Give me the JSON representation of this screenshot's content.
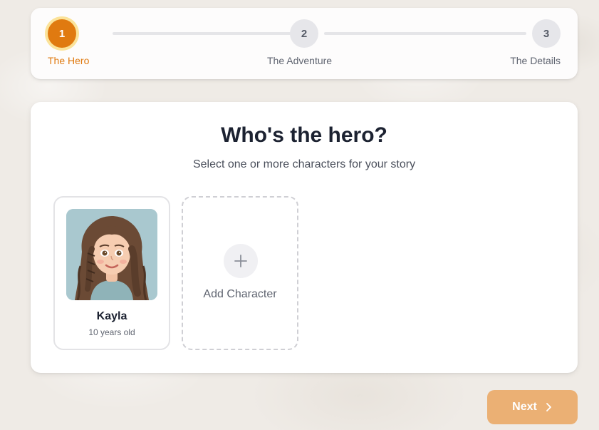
{
  "stepper": {
    "steps": [
      {
        "number": "1",
        "label": "The Hero"
      },
      {
        "number": "2",
        "label": "The Adventure"
      },
      {
        "number": "3",
        "label": "The Details"
      }
    ],
    "active_step": 1,
    "active_color": "#e07a10"
  },
  "main": {
    "title": "Who's the hero?",
    "subtitle": "Select one or more characters for your story",
    "characters": [
      {
        "name": "Kayla",
        "age": "10 years old"
      }
    ],
    "add_character_label": "Add Character"
  },
  "footer": {
    "next_label": "Next"
  },
  "icons": {
    "plus": "plus-icon",
    "next": "chevron-right-icon"
  }
}
